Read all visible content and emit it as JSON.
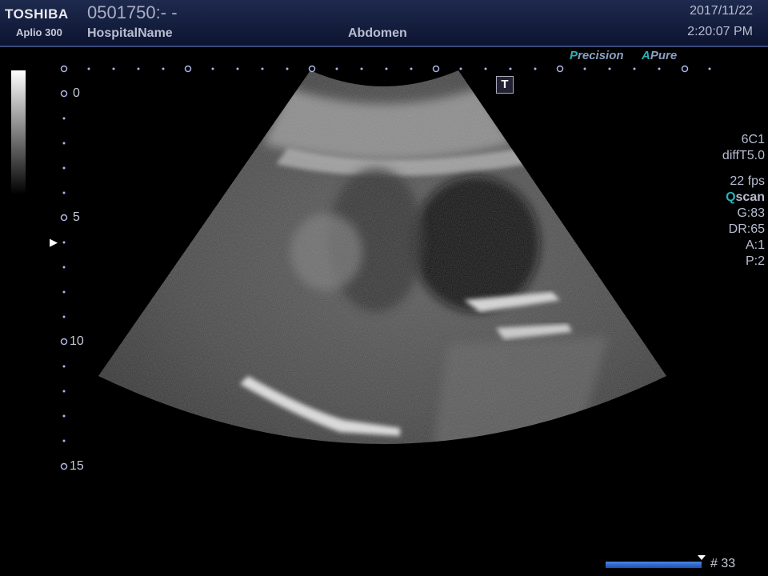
{
  "header": {
    "brand": "TOSHIBA",
    "model": "Aplio 300",
    "patient_id": "0501750:- -",
    "hospital": "HospitalName",
    "exam": "Abdomen",
    "date": "2017/11/22",
    "time": "2:20:07 PM"
  },
  "badges": {
    "precision_first": "P",
    "precision_rest": "recision",
    "apure_first": "A",
    "apure_rest": "Pure",
    "accent_color": "#2bb0b8"
  },
  "t_marker": "T",
  "params": {
    "probe": "6C1",
    "harmonic": "diffT5.0",
    "fps": "22 fps",
    "qscan_first": "Q",
    "qscan_rest": "scan",
    "gain": "G:83",
    "dynamic_range": "DR:65",
    "a": "A:1",
    "p": "P:2"
  },
  "depth_labels": [
    "0",
    "5",
    "10",
    "15"
  ],
  "focus_marker": "▶",
  "cine": {
    "frame": "# 33",
    "position": 1.0
  }
}
